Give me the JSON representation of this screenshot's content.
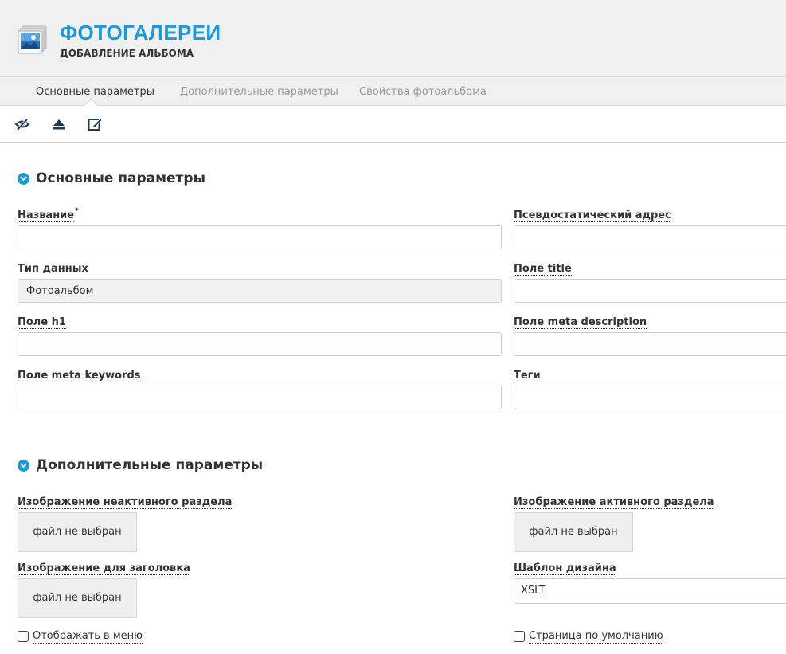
{
  "header": {
    "title": "ФОТОГАЛЕРЕИ",
    "subtitle": "ДОБАВЛЕНИЕ АЛЬБОМА"
  },
  "tabs": [
    {
      "label": "Основные параметры",
      "active": true
    },
    {
      "label": "Дополнительные параметры",
      "active": false
    },
    {
      "label": "Свойства фотоальбома",
      "active": false
    }
  ],
  "toolbar": {
    "icons": [
      "eye-slash-icon",
      "eject-icon",
      "edit-icon"
    ]
  },
  "sections": {
    "main": {
      "title": "Основные параметры",
      "fields": {
        "name": {
          "label": "Название",
          "required_mark": "*",
          "value": ""
        },
        "alt_name": {
          "label": "Псевдостатический адрес",
          "value": ""
        },
        "data_type": {
          "label": "Тип данных",
          "value": "Фотоальбом"
        },
        "title_field": {
          "label": "Поле title",
          "value": ""
        },
        "h1": {
          "label": "Поле h1",
          "value": ""
        },
        "meta_description": {
          "label": "Поле meta description",
          "value": ""
        },
        "meta_keywords": {
          "label": "Поле meta keywords",
          "value": ""
        },
        "tags": {
          "label": "Теги",
          "value": ""
        }
      }
    },
    "extra": {
      "title": "Дополнительные параметры",
      "fields": {
        "inactive_image": {
          "label": "Изображение неактивного раздела",
          "value": "файл не выбран"
        },
        "active_image": {
          "label": "Изображение активного раздела",
          "value": "файл не выбран"
        },
        "header_image": {
          "label": "Изображение для заголовка",
          "value": "файл не выбран"
        },
        "template": {
          "label": "Шаблон дизайна",
          "value": "XSLT"
        },
        "show_in_menu": {
          "label": "Отображать в меню",
          "checked": false
        },
        "default_page": {
          "label": "Страница по умолчанию",
          "checked": false
        }
      }
    }
  },
  "colors": {
    "accent": "#1a9ad6",
    "header_bg": "#f0f0f0",
    "text": "#333333",
    "muted_tab": "#9a9a9a"
  }
}
